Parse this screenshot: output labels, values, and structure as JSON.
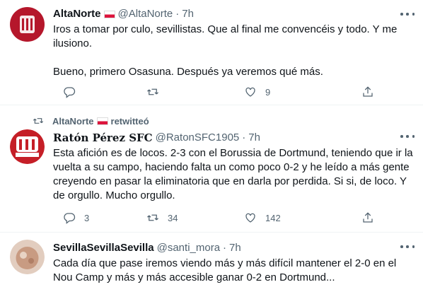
{
  "tweets": [
    {
      "name": "AltaNorte",
      "handle": "@AltaNorte",
      "time": "7h",
      "lines": [
        "Iros a tomar por culo, sevillistas. Que al final me convencéis y todo. Y me ilusiono.",
        "Bueno, primero Osasuna. Después ya veremos qué más."
      ],
      "reply_count": "",
      "retweet_count": "",
      "like_count": "9"
    },
    {
      "retweeted_by": "AltaNorte",
      "retweeted_label": "retwitteó",
      "name": "Ratón Pérez SFC",
      "handle": "@RatonSFC1905",
      "time": "7h",
      "text": "Esta afición es de locos. 2-3 con el Borussia de Dortmund, teniendo que ir la vuelta a su campo, haciendo falta un como poco 0-2 y he leído a más gente creyendo en pasar la eliminatoria que en darla por perdida. Si si, de loco. Y de orgullo. Mucho orgullo.",
      "reply_count": "3",
      "retweet_count": "34",
      "like_count": "142"
    },
    {
      "name": "SevillaSevillaSevilla",
      "handle": "@santi_mora",
      "time": "7h",
      "text": "Cada día que pase iremos viendo más y más difícil mantener el 2-0 en el Nou Camp y más y más accesible ganar 0-2 en Dortmund..."
    }
  ],
  "icons": [
    "reply-icon",
    "retweet-icon",
    "like-icon",
    "share-icon",
    "more-icon"
  ],
  "colors": {
    "flag_red": "#dc143c",
    "muted": "#536471",
    "divider": "#eff3f4"
  }
}
